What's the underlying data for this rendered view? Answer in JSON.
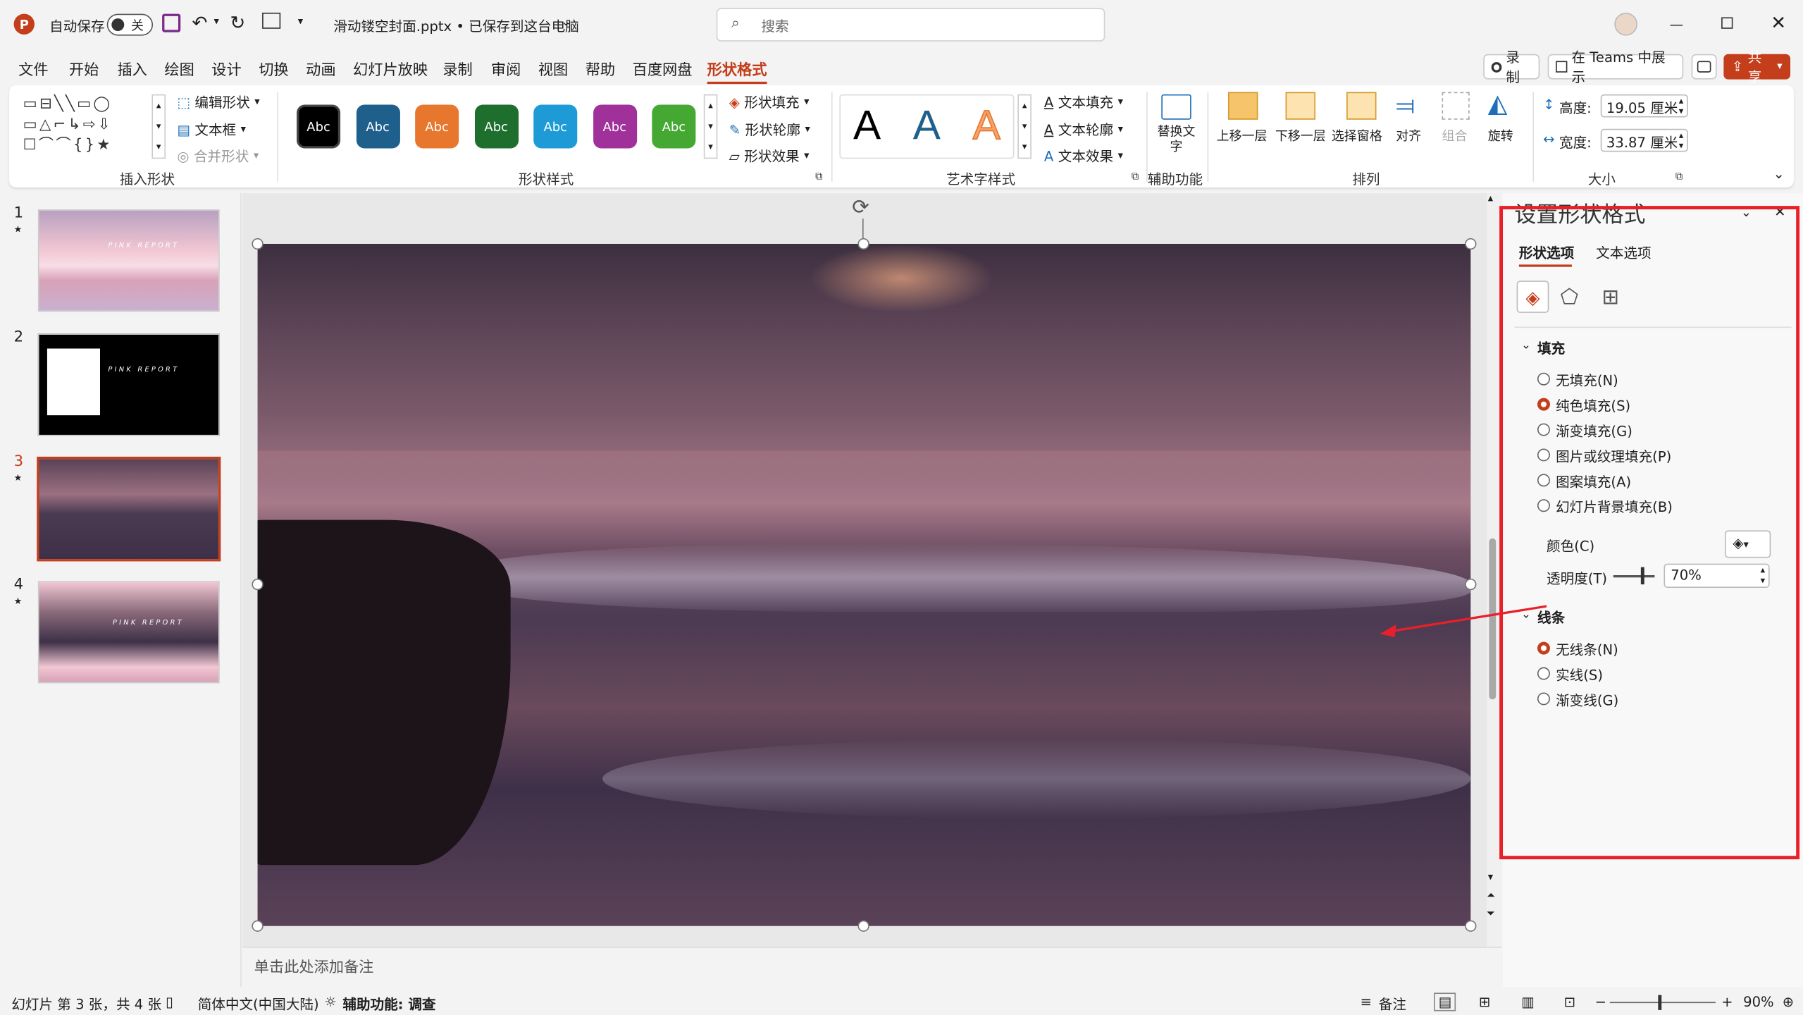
{
  "titlebar": {
    "autosave_label": "自动保存",
    "autosave_state": "关",
    "file_title": "滑动镂空封面.pptx • 已保存到这台电脑",
    "search_placeholder": "搜索"
  },
  "menu": {
    "items": [
      "文件",
      "开始",
      "插入",
      "绘图",
      "设计",
      "切换",
      "动画",
      "幻灯片放映",
      "录制",
      "审阅",
      "视图",
      "帮助",
      "百度网盘",
      "形状格式"
    ],
    "active": "形状格式",
    "record_label": "录制",
    "teams_label": "在 Teams 中展示",
    "share_label": "共享"
  },
  "ribbon": {
    "insert_shapes": {
      "edit_shape": "编辑形状",
      "text_box": "文本框",
      "merge_shapes": "合并形状",
      "label": "插入形状"
    },
    "shape_styles": {
      "swatch_label": "Abc",
      "swatches": [
        "#000000",
        "#1f5f8b",
        "#e8772e",
        "#1e6e2e",
        "#1e9bd7",
        "#a0309a",
        "#44a832"
      ],
      "fill": "形状填充",
      "outline": "形状轮廓",
      "effects": "形状效果",
      "label": "形状样式"
    },
    "wordart": {
      "glyph": "A",
      "text_fill": "文本填充",
      "text_outline": "文本轮廓",
      "text_effects": "文本效果",
      "label": "艺术字样式"
    },
    "accessibility": {
      "alt_text": "替换文字",
      "label": "辅助功能"
    },
    "arrange": {
      "bring_forward": "上移一层",
      "send_backward": "下移一层",
      "selection_pane": "选择窗格",
      "align": "对齐",
      "group": "组合",
      "rotate": "旋转",
      "label": "排列"
    },
    "size": {
      "height_label": "高度:",
      "height_value": "19.05 厘米",
      "width_label": "宽度:",
      "width_value": "33.87 厘米",
      "label": "大小"
    }
  },
  "thumbnails": [
    {
      "num": "1",
      "text": "PINK REPORT"
    },
    {
      "num": "2",
      "text": "PINK REPORT"
    },
    {
      "num": "3",
      "text": ""
    },
    {
      "num": "4",
      "text": "PINK REPORT"
    }
  ],
  "selected_slide": 3,
  "notes_placeholder": "单击此处添加备注",
  "format_pane": {
    "title": "设置形状格式",
    "tab_shape": "形状选项",
    "tab_text": "文本选项",
    "fill_section": "填充",
    "fill_options": [
      "无填充(N)",
      "纯色填充(S)",
      "渐变填充(G)",
      "图片或纹理填充(P)",
      "图案填充(A)",
      "幻灯片背景填充(B)"
    ],
    "fill_selected": 1,
    "color_label": "颜色(C)",
    "transparency_label": "透明度(T)",
    "transparency_value": "70%",
    "transparency": 0.7,
    "line_section": "线条",
    "line_options": [
      "无线条(N)",
      "实线(S)",
      "渐变线(G)"
    ],
    "line_selected": 0,
    "highlight_color": "#e8202a"
  },
  "statusbar": {
    "slide_info": "幻灯片 第 3 张，共 4 张",
    "language": "简体中文(中国大陆)",
    "accessibility": "辅助功能: 调查",
    "notes": "备注",
    "zoom": "90%"
  },
  "colors": {
    "accent": "#c43e1c",
    "annotation": "#e8202a"
  }
}
